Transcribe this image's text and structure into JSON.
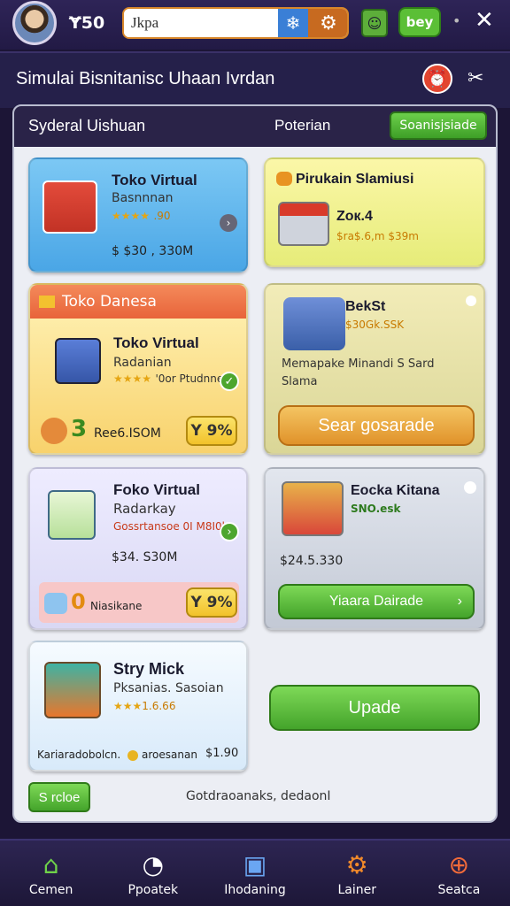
{
  "topbar": {
    "coins": "Ɏ50",
    "search_value": "Jkpa",
    "buy_label": "bey"
  },
  "header": {
    "title": "Simulai Bisnitanisc Uhaan Ivrdan"
  },
  "panel": {
    "left_label": "Syderal Uishuan",
    "mid_label": "Poterian",
    "action_label": "Soanisjsiade"
  },
  "cards": [
    {
      "title": "Toko Virtual",
      "subtitle": "Basnnnan",
      "stars": "★★★★",
      "stars_text": ".90",
      "price": "$ $30 , 330M"
    },
    {
      "title": "Pirukain Slamiusi",
      "subtitle": "Zoк.4",
      "small": "$ra$.6,m $39m"
    },
    {
      "ribbon": "Toko Danesa",
      "title": "Toko Virtual",
      "subtitle": "Radanian",
      "stars": "★★★★",
      "stars_text": "'0or Ptudnnei",
      "price": "Ree6.ISOM",
      "count": "3",
      "btn": "Y 9%"
    },
    {
      "title": "BekSt",
      "small": "$30Gk.SSK",
      "desc_1": "Memapake Minandi S Sard",
      "desc_2": "Slama",
      "btn": "Sear gosarade"
    },
    {
      "title": "Foko Virtual",
      "subtitle": "Radarkay",
      "small": "Gossrtansoe 0I M8I0h",
      "price": "$34. S30M",
      "count": "0",
      "count_label": "Niasikane",
      "btn": "Y 9%"
    },
    {
      "title": "Eocka Kitana",
      "small": "SNO.esk",
      "price": "$24.5.330",
      "btn": "Yiaara Dairade"
    },
    {
      "title": "Stry Mick",
      "subtitle": "Pksanias. Sasoian",
      "stars": "★★★",
      "stars_text": "1.6.66",
      "footer": "Kariaradobolcn.",
      "footer_b": "aroesanan",
      "footer_price": "$1.90"
    },
    {
      "btn": "Upade"
    }
  ],
  "footer": {
    "left_btn": "S rcloe",
    "center_text": "Gotdraoanaks, dedaonI"
  },
  "nav": [
    {
      "label": "Cemen",
      "icon": "home-icon"
    },
    {
      "label": "Ppoatek",
      "icon": "dashboard-icon"
    },
    {
      "label": "Ihodaning",
      "icon": "book-icon"
    },
    {
      "label": "Lainer",
      "icon": "gear-icon"
    },
    {
      "label": "Seatca",
      "icon": "add-icon"
    }
  ],
  "colors": {
    "accent": "#5bbf36",
    "background": "#1c1536",
    "panel": "#eceef4"
  }
}
